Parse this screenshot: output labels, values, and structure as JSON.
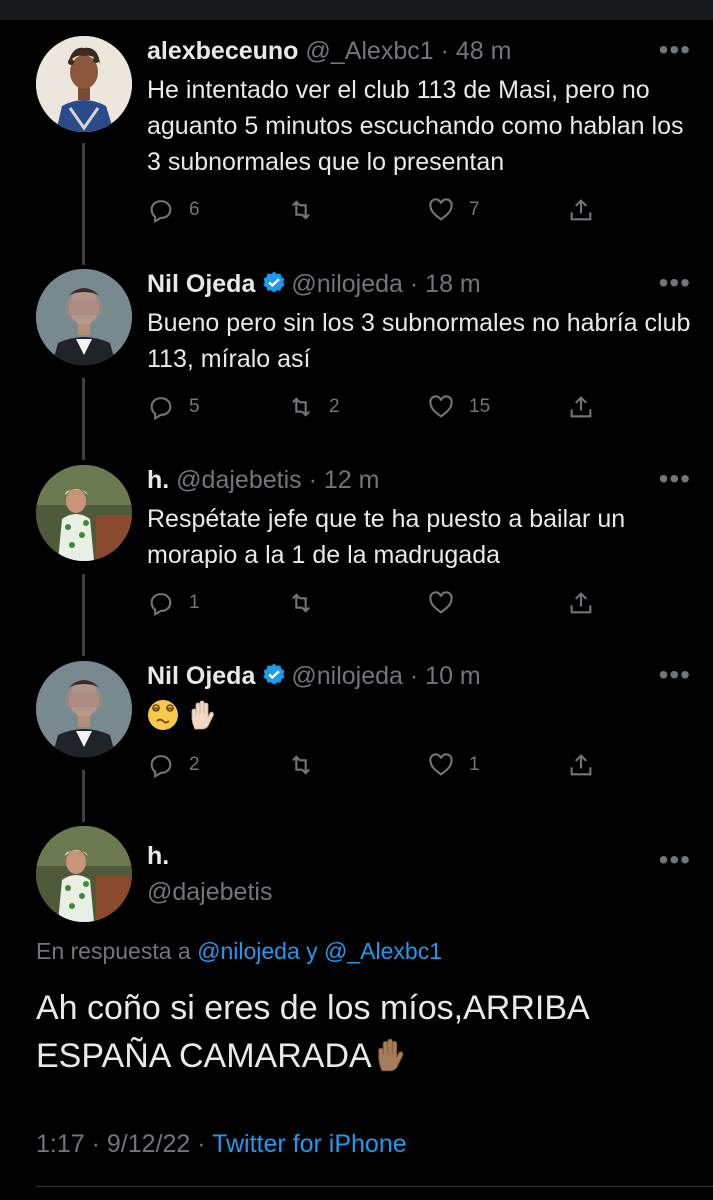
{
  "tweets": [
    {
      "name": "alexbeceuno",
      "handle": "@_Alexbc1",
      "dot": "·",
      "time": "48 m",
      "text": "He intentado ver el club 113 de Masi, pero no aguanto 5 minutos escuchando como hablan los 3 subnormales que lo presentan",
      "replies": "6",
      "retweets": "",
      "likes": "7",
      "verified": false
    },
    {
      "name": "Nil Ojeda",
      "handle": "@nilojeda",
      "dot": "·",
      "time": "18 m",
      "text": "Bueno pero sin los 3 subnormales no habría club 113, míralo así",
      "replies": "5",
      "retweets": "2",
      "likes": "15",
      "verified": true
    },
    {
      "name": "h.",
      "handle": "@dajebetis",
      "dot": "·",
      "time": "12 m",
      "text": "Respétate jefe que te ha puesto a bailar un morapio a la 1 de la madrugada",
      "replies": "1",
      "retweets": "",
      "likes": "",
      "verified": false
    },
    {
      "name": "Nil Ojeda",
      "handle": "@nilojeda",
      "dot": "·",
      "time": "10 m",
      "text": "",
      "replies": "2",
      "retweets": "",
      "likes": "1",
      "verified": true
    }
  ],
  "main": {
    "name": "h.",
    "handle": "@dajebetis",
    "reply_prefix": "En respuesta a",
    "reply_user1": "@nilojeda",
    "reply_and": "y",
    "reply_user2": "@_Alexbc1",
    "text_line1": "Ah coño si eres de los míos,ARRIBA",
    "text_line2": "ESPAÑA CAMARADA",
    "time": "1:17",
    "dot": "·",
    "date": "9/12/22",
    "source": "Twitter for iPhone"
  },
  "more_label": "•••",
  "colors": {
    "accent": "#1d9bf0",
    "muted": "#71767b",
    "text": "#e7e9ea",
    "background": "#000000"
  }
}
